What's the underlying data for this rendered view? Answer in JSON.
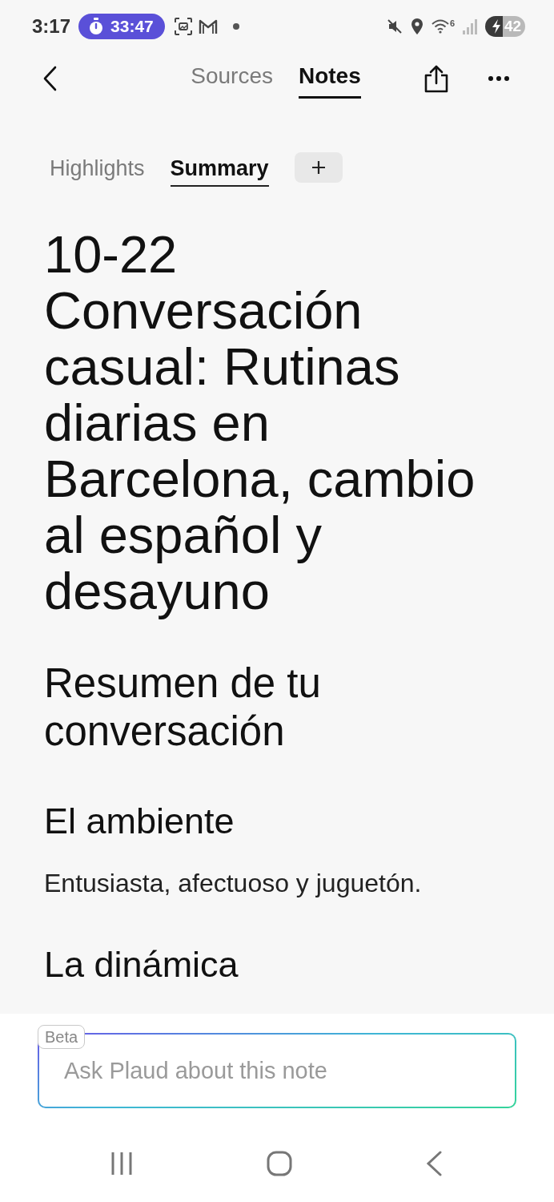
{
  "status_bar": {
    "time": "3:17",
    "timer": "33:47",
    "wifi_label": "6",
    "battery": "42"
  },
  "nav": {
    "tabs": [
      {
        "label": "Sources",
        "selected": false
      },
      {
        "label": "Notes",
        "selected": true
      }
    ]
  },
  "note_tabs": [
    {
      "label": "Highlights",
      "selected": false
    },
    {
      "label": "Summary",
      "selected": true
    }
  ],
  "note": {
    "title": "10-22 Conversación casual: Rutinas diarias en Barcelona, cambio al español y desayuno",
    "blocks": [
      {
        "kind": "heading",
        "text": "Resumen de tu conversación"
      },
      {
        "kind": "subheading",
        "text": "El ambiente"
      },
      {
        "kind": "paragraph",
        "text": "Entusiasta, afectuoso y juguetón."
      },
      {
        "kind": "subheading",
        "text": "La dinámica"
      }
    ]
  },
  "ask": {
    "badge": "Beta",
    "placeholder": "Ask Plaud about this note"
  }
}
